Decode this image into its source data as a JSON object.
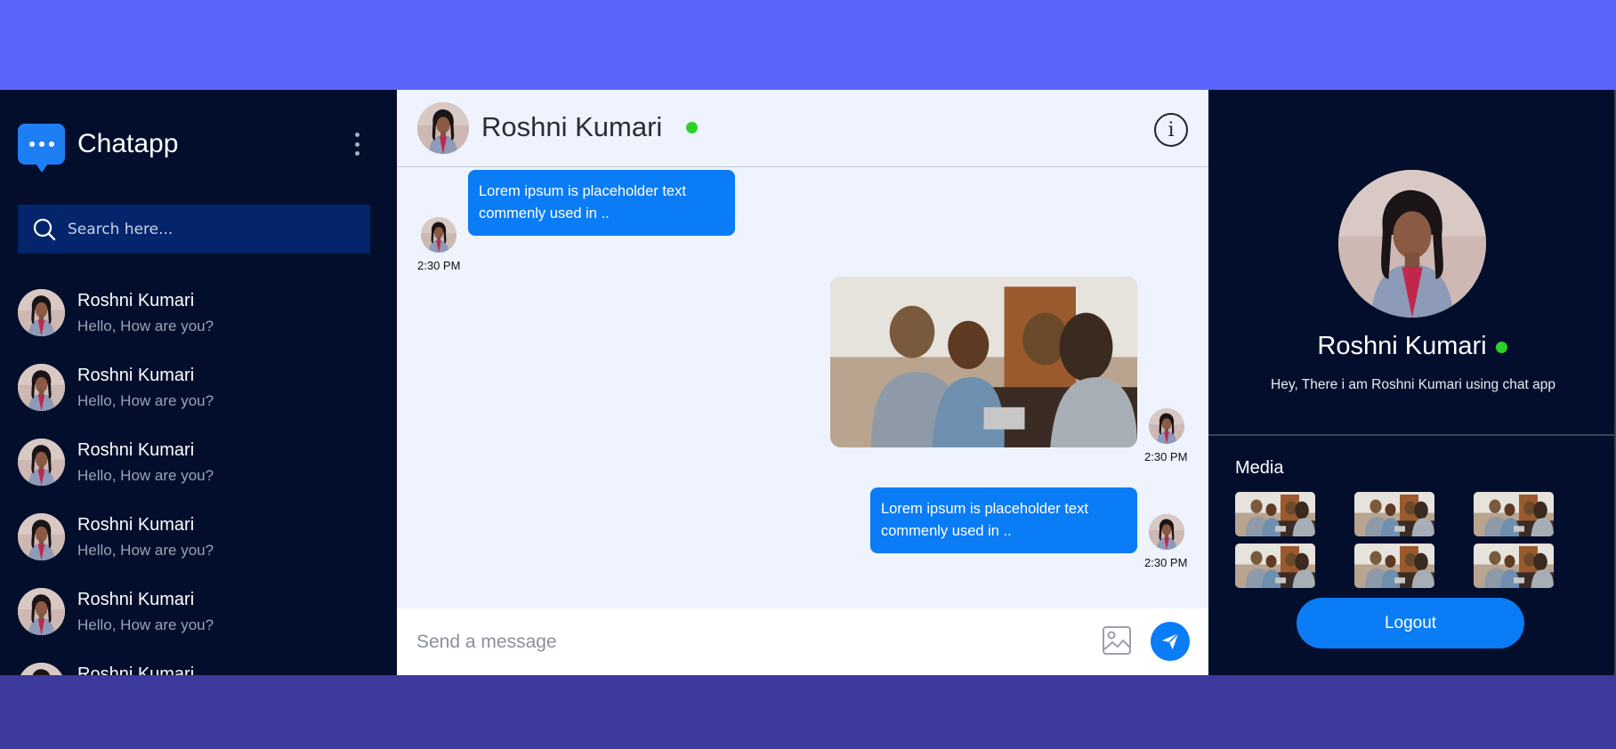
{
  "app": {
    "name": "Chatapp"
  },
  "search": {
    "placeholder": "Search here..."
  },
  "contacts": [
    {
      "name": "Roshni Kumari",
      "preview": "Hello, How are you?"
    },
    {
      "name": "Roshni Kumari",
      "preview": "Hello, How are you?"
    },
    {
      "name": "Roshni Kumari",
      "preview": "Hello, How are you?"
    },
    {
      "name": "Roshni Kumari",
      "preview": "Hello, How are you?"
    },
    {
      "name": "Roshni Kumari",
      "preview": "Hello, How are you?"
    },
    {
      "name": "Roshni Kumari",
      "preview": ""
    }
  ],
  "chat": {
    "contact_name": "Roshni Kumari",
    "messages": [
      {
        "type": "text",
        "text": "Lorem ipsum is placeholder text commenly used in ..",
        "time": "2:30 PM",
        "direction": "incoming"
      },
      {
        "type": "image",
        "time": "2:30 PM",
        "direction": "outgoing"
      },
      {
        "type": "text",
        "text": "Lorem ipsum is placeholder text commenly used in ..",
        "time": "2:30 PM",
        "direction": "outgoing"
      }
    ]
  },
  "composer": {
    "placeholder": "Send a message"
  },
  "profile": {
    "name": "Roshni Kumari",
    "status": "Hey, There i am Roshni Kumari using chat app",
    "media_title": "Media",
    "logout_label": "Logout"
  },
  "colors": {
    "accent": "#0a7cf5",
    "sidebar_bg": "#020e2c",
    "chat_bg": "#eef3fd",
    "online": "#2bd12b"
  }
}
